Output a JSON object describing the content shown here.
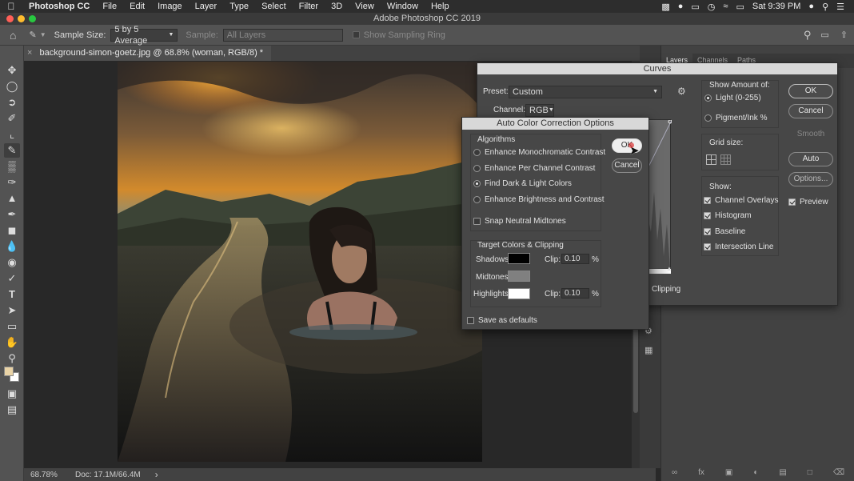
{
  "menubar": {
    "app": "Photoshop CC",
    "items": [
      "File",
      "Edit",
      "Image",
      "Layer",
      "Type",
      "Select",
      "Filter",
      "3D",
      "View",
      "Window",
      "Help"
    ],
    "clock": "Sat 9:39 PM"
  },
  "window": {
    "title": "Adobe Photoshop CC 2019"
  },
  "options": {
    "sample_size_label": "Sample Size:",
    "sample_size_value": "5 by 5 Average",
    "sample_label": "Sample:",
    "sample_value": "All Layers",
    "sampling_ring": "Show Sampling Ring"
  },
  "document": {
    "tab": "background-simon-goetz.jpg @ 68.8% (woman, RGB/8) *",
    "close": "×"
  },
  "status": {
    "zoom": "68.78%",
    "doc": "Doc: 17.1M/66.4M",
    "arrow": "›"
  },
  "panels": {
    "tabs": [
      "Layers",
      "Channels",
      "Paths"
    ],
    "clipping": "Clipping"
  },
  "curves": {
    "title": "Curves",
    "preset_label": "Preset:",
    "preset_value": "Custom",
    "channel_label": "Channel:",
    "channel_value": "RGB",
    "show_amount_label": "Show Amount of:",
    "light_label": "Light  (0-255)",
    "pigment_label": "Pigment/Ink %",
    "grid_size_label": "Grid size:",
    "show_label": "Show:",
    "show_options": [
      "Channel Overlays",
      "Histogram",
      "Baseline",
      "Intersection Line"
    ],
    "ok": "OK",
    "cancel": "Cancel",
    "smooth": "Smooth",
    "auto": "Auto",
    "options": "Options...",
    "preview": "Preview"
  },
  "auto_color": {
    "title": "Auto Color Correction Options",
    "algorithms_label": "Algorithms",
    "algorithms": [
      "Enhance Monochromatic Contrast",
      "Enhance Per Channel Contrast",
      "Find Dark & Light Colors",
      "Enhance Brightness and Contrast"
    ],
    "selected_algorithm": 2,
    "snap_neutral": "Snap Neutral Midtones",
    "target_label": "Target Colors & Clipping",
    "shadows_label": "Shadows:",
    "midtones_label": "Midtones:",
    "highlights_label": "Highlights:",
    "clip_label": "Clip:",
    "shadows_clip": "0.10",
    "highlights_clip": "0.10",
    "percent": "%",
    "save_defaults": "Save as defaults",
    "ok": "OK",
    "cancel": "Cancel",
    "colors": {
      "shadows": "#000000",
      "midtones": "#808080",
      "highlights": "#ffffff"
    }
  }
}
